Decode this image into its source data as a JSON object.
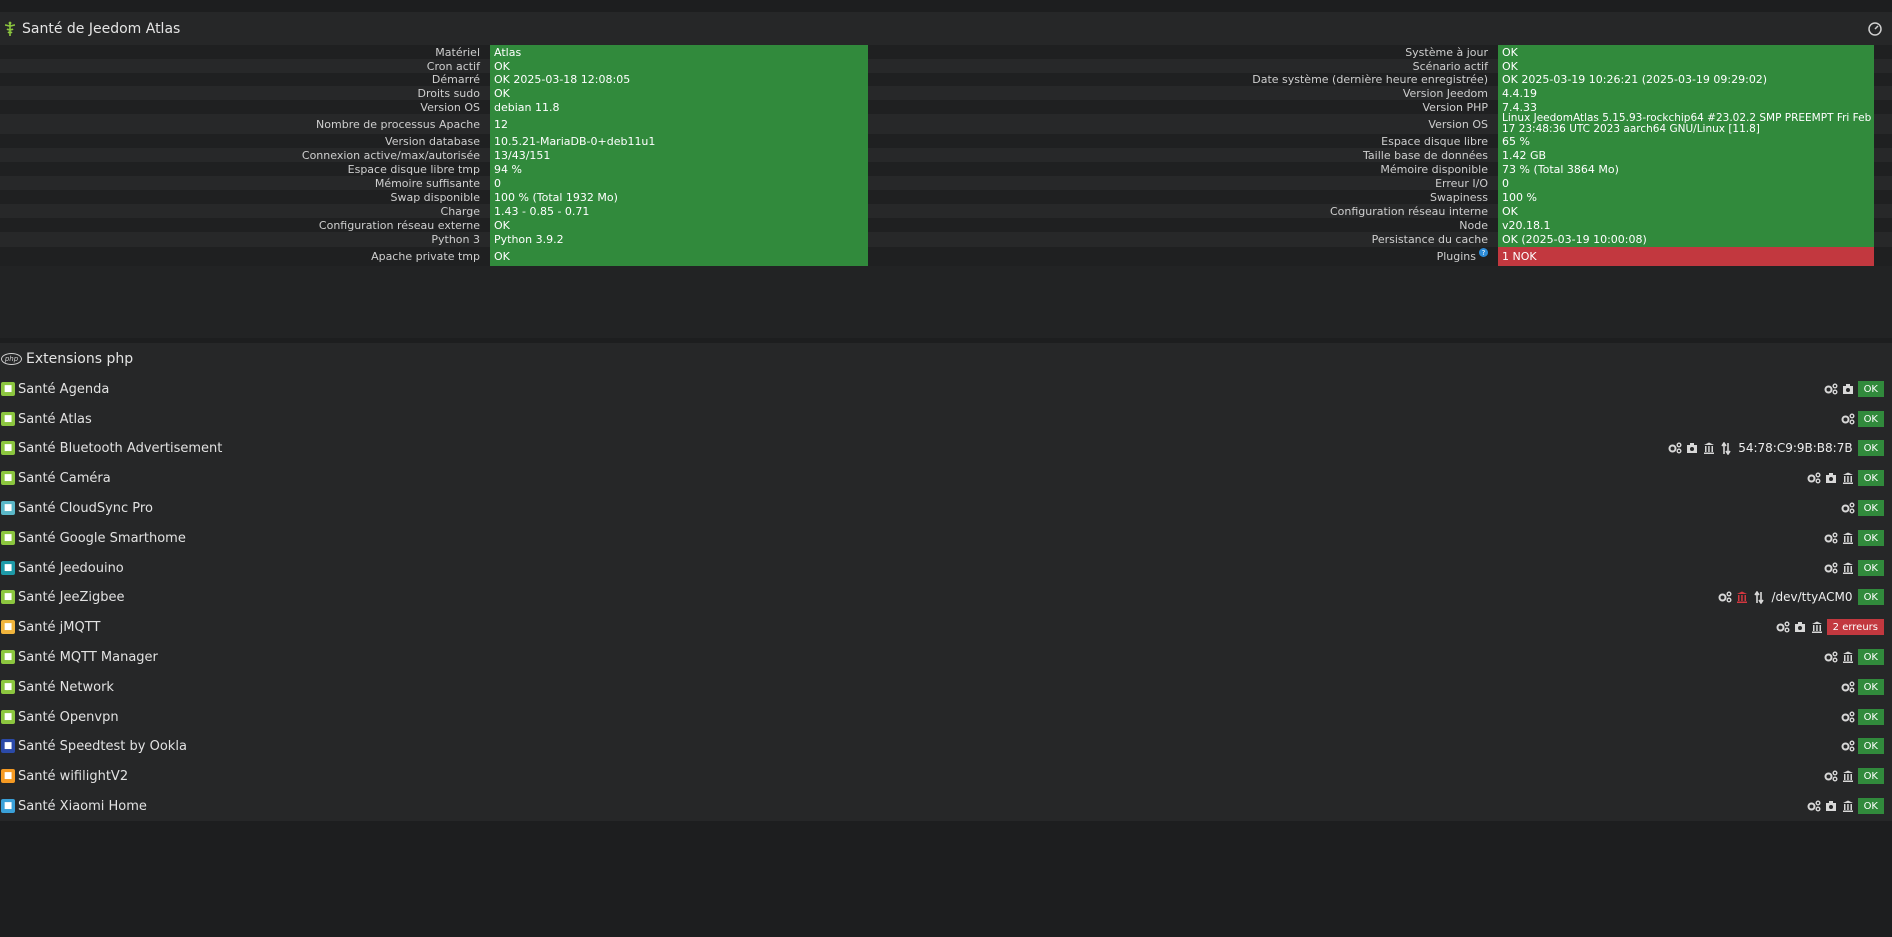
{
  "health": {
    "title": "Santé de Jeedom Atlas",
    "left": [
      {
        "label": "Matériel",
        "value": "Atlas",
        "status": "ok"
      },
      {
        "label": "Cron actif",
        "value": "OK",
        "status": "ok"
      },
      {
        "label": "Démarré",
        "value": "OK 2025-03-18 12:08:05",
        "status": "ok"
      },
      {
        "label": "Droits sudo",
        "value": "OK",
        "status": "ok"
      },
      {
        "label": "Version OS",
        "value": "debian 11.8",
        "status": "ok"
      },
      {
        "label": "Nombre de processus Apache",
        "value": "12",
        "status": "ok"
      },
      {
        "label": "Version database",
        "value": "10.5.21-MariaDB-0+deb11u1",
        "status": "ok"
      },
      {
        "label": "Connexion active/max/autorisée",
        "value": "13/43/151",
        "status": "ok"
      },
      {
        "label": "Espace disque libre tmp",
        "value": "94 %",
        "status": "ok"
      },
      {
        "label": "Mémoire suffisante",
        "value": "0",
        "status": "ok"
      },
      {
        "label": "Swap disponible",
        "value": "100 % (Total 1932 Mo)",
        "status": "ok"
      },
      {
        "label": "Charge",
        "value": "1.43 - 0.85 - 0.71",
        "status": "ok"
      },
      {
        "label": "Configuration réseau externe",
        "value": "OK",
        "status": "ok"
      },
      {
        "label": "Python 3",
        "value": "Python 3.9.2",
        "status": "ok"
      },
      {
        "label": "Apache private tmp",
        "value": "OK",
        "status": "ok"
      }
    ],
    "right": [
      {
        "label": "Système à jour",
        "value": "OK",
        "status": "ok"
      },
      {
        "label": "Scénario actif",
        "value": "OK",
        "status": "ok"
      },
      {
        "label": "Date système (dernière heure enregistrée)",
        "value": "OK 2025-03-19 10:26:21 (2025-03-19 09:29:02)",
        "status": "ok"
      },
      {
        "label": "Version Jeedom",
        "value": "4.4.19",
        "status": "ok"
      },
      {
        "label": "Version PHP",
        "value": "7.4.33",
        "status": "ok"
      },
      {
        "label": "Version OS",
        "value": "Linux JeedomAtlas 5.15.93-rockchip64 #23.02.2 SMP PREEMPT Fri Feb 17 23:48:36 UTC 2023 aarch64 GNU/Linux [11.8]",
        "status": "ok"
      },
      {
        "label": "Espace disque libre",
        "value": "65 %",
        "status": "ok"
      },
      {
        "label": "Taille base de données",
        "value": "1.42 GB",
        "status": "ok"
      },
      {
        "label": "Mémoire disponible",
        "value": "73 % (Total 3864 Mo)",
        "status": "ok"
      },
      {
        "label": "Erreur I/O",
        "value": "0",
        "status": "ok"
      },
      {
        "label": "Swapiness",
        "value": "100 %",
        "status": "ok"
      },
      {
        "label": "Configuration réseau interne",
        "value": "OK",
        "status": "ok"
      },
      {
        "label": "Node",
        "value": "v20.18.1",
        "status": "ok"
      },
      {
        "label": "Persistance du cache",
        "value": "OK (2025-03-19 10:00:08)",
        "status": "ok"
      },
      {
        "label": "Plugins",
        "value": "1 NOK",
        "status": "nok"
      }
    ]
  },
  "extensions": {
    "title": "Extensions php",
    "php_badge": "php"
  },
  "plugins": [
    {
      "name": "Santé Agenda",
      "icon_color": "#8cc63f",
      "icons": [
        "gears-icon",
        "camera-icon"
      ],
      "port": "",
      "badge": "OK",
      "badge_status": "ok"
    },
    {
      "name": "Santé Atlas",
      "icon_color": "#8cc63f",
      "icons": [
        "gears-icon"
      ],
      "port": "",
      "badge": "OK",
      "badge_status": "ok"
    },
    {
      "name": "Santé Bluetooth Advertisement",
      "icon_color": "#8cc63f",
      "icons": [
        "gears-icon",
        "camera-icon",
        "bank-icon",
        "arrows-icon"
      ],
      "port": "54:78:C9:9B:B8:7B",
      "badge": "OK",
      "badge_status": "ok"
    },
    {
      "name": "Santé Caméra",
      "icon_color": "#8cc63f",
      "icons": [
        "gears-icon",
        "camera-icon",
        "bank-icon"
      ],
      "port": "",
      "badge": "OK",
      "badge_status": "ok"
    },
    {
      "name": "Santé CloudSync Pro",
      "icon_color": "#5bb8c9",
      "icons": [
        "gears-icon"
      ],
      "port": "",
      "badge": "OK",
      "badge_status": "ok"
    },
    {
      "name": "Santé Google Smarthome",
      "icon_color": "#8cc63f",
      "icons": [
        "gears-icon",
        "bank-icon"
      ],
      "port": "",
      "badge": "OK",
      "badge_status": "ok"
    },
    {
      "name": "Santé Jeedouino",
      "icon_color": "#1e9aa8",
      "icons": [
        "gears-icon",
        "bank-icon"
      ],
      "port": "",
      "badge": "OK",
      "badge_status": "ok"
    },
    {
      "name": "Santé JeeZigbee",
      "icon_color": "#8cc63f",
      "icons": [
        "gears-icon",
        "bank-icon-red",
        "arrows-icon"
      ],
      "port": "/dev/ttyACM0",
      "badge": "OK",
      "badge_status": "ok"
    },
    {
      "name": "Santé jMQTT",
      "icon_color": "#f0b43c",
      "icons": [
        "gears-icon",
        "camera-icon",
        "bank-icon"
      ],
      "port": "",
      "badge": "2 erreurs",
      "badge_status": "err"
    },
    {
      "name": "Santé MQTT Manager",
      "icon_color": "#8cc63f",
      "icons": [
        "gears-icon",
        "bank-icon"
      ],
      "port": "",
      "badge": "OK",
      "badge_status": "ok"
    },
    {
      "name": "Santé Network",
      "icon_color": "#8cc63f",
      "icons": [
        "gears-icon"
      ],
      "port": "",
      "badge": "OK",
      "badge_status": "ok"
    },
    {
      "name": "Santé Openvpn",
      "icon_color": "#8cc63f",
      "icons": [
        "gears-icon"
      ],
      "port": "",
      "badge": "OK",
      "badge_status": "ok"
    },
    {
      "name": "Santé Speedtest by Ookla",
      "icon_color": "#2b4aa8",
      "icons": [
        "gears-icon"
      ],
      "port": "",
      "badge": "OK",
      "badge_status": "ok"
    },
    {
      "name": "Santé wifilightV2",
      "icon_color": "#f59a23",
      "icons": [
        "gears-icon",
        "bank-icon"
      ],
      "port": "",
      "badge": "OK",
      "badge_status": "ok"
    },
    {
      "name": "Santé Xiaomi Home",
      "icon_color": "#3aa0d8",
      "icons": [
        "gears-icon",
        "camera-icon",
        "bank-icon"
      ],
      "port": "",
      "badge": "OK",
      "badge_status": "ok"
    }
  ]
}
